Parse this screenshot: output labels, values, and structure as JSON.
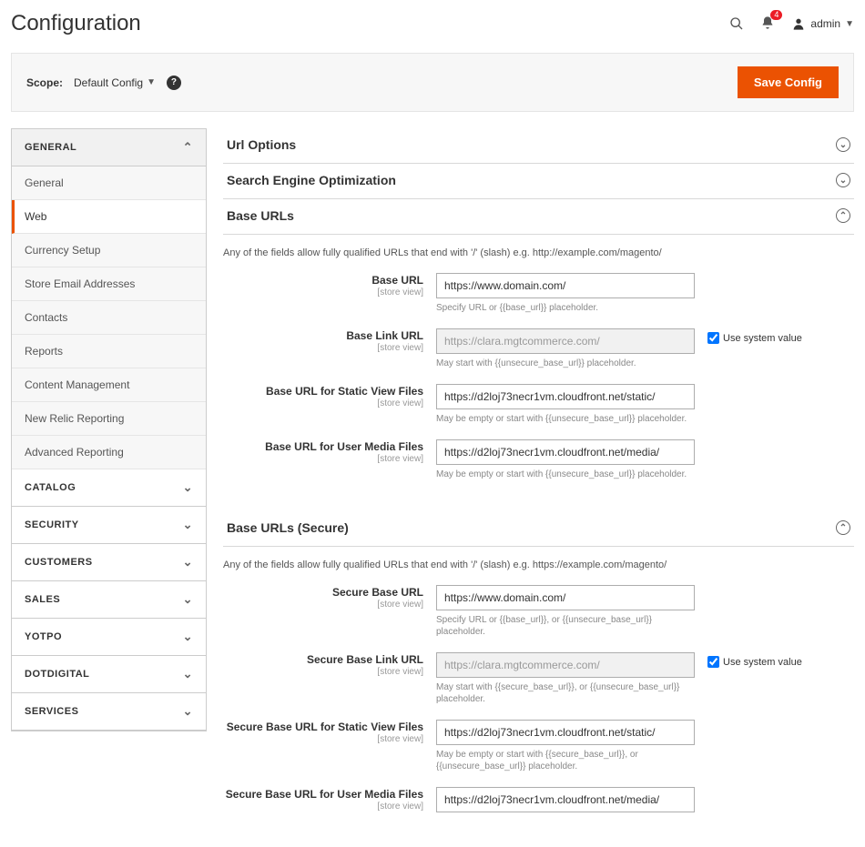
{
  "header": {
    "title": "Configuration",
    "notification_count": "4",
    "username": "admin"
  },
  "scopebar": {
    "label": "Scope:",
    "selected": "Default Config",
    "save_label": "Save Config"
  },
  "sidebar": {
    "groups": [
      {
        "label": "GENERAL",
        "expanded": true,
        "items": [
          {
            "label": "General"
          },
          {
            "label": "Web",
            "active": true
          },
          {
            "label": "Currency Setup"
          },
          {
            "label": "Store Email Addresses"
          },
          {
            "label": "Contacts"
          },
          {
            "label": "Reports"
          },
          {
            "label": "Content Management"
          },
          {
            "label": "New Relic Reporting"
          },
          {
            "label": "Advanced Reporting"
          }
        ]
      },
      {
        "label": "CATALOG",
        "expanded": false
      },
      {
        "label": "SECURITY",
        "expanded": false
      },
      {
        "label": "CUSTOMERS",
        "expanded": false
      },
      {
        "label": "SALES",
        "expanded": false
      },
      {
        "label": "YOTPO",
        "expanded": false
      },
      {
        "label": "DOTDIGITAL",
        "expanded": false
      },
      {
        "label": "SERVICES",
        "expanded": false
      }
    ]
  },
  "sections": {
    "url_options": {
      "title": "Url Options"
    },
    "seo": {
      "title": "Search Engine Optimization"
    },
    "base_urls": {
      "title": "Base URLs",
      "note": "Any of the fields allow fully qualified URLs that end with '/' (slash) e.g. http://example.com/magento/",
      "fields": {
        "base_url": {
          "label": "Base URL",
          "scope": "[store view]",
          "value": "https://www.domain.com/",
          "help": "Specify URL or {{base_url}} placeholder."
        },
        "base_link_url": {
          "label": "Base Link URL",
          "scope": "[store view]",
          "value": "https://clara.mgtcommerce.com/",
          "help": "May start with {{unsecure_base_url}} placeholder.",
          "use_system": true,
          "use_system_label": "Use system value"
        },
        "static_url": {
          "label": "Base URL for Static View Files",
          "scope": "[store view]",
          "value": "https://d2loj73necr1vm.cloudfront.net/static/",
          "help": "May be empty or start with {{unsecure_base_url}} placeholder."
        },
        "media_url": {
          "label": "Base URL for User Media Files",
          "scope": "[store view]",
          "value": "https://d2loj73necr1vm.cloudfront.net/media/",
          "help": "May be empty or start with {{unsecure_base_url}} placeholder."
        }
      }
    },
    "base_urls_secure": {
      "title": "Base URLs (Secure)",
      "note": "Any of the fields allow fully qualified URLs that end with '/' (slash) e.g. https://example.com/magento/",
      "fields": {
        "secure_base_url": {
          "label": "Secure Base URL",
          "scope": "[store view]",
          "value": "https://www.domain.com/",
          "help": "Specify URL or {{base_url}}, or {{unsecure_base_url}} placeholder."
        },
        "secure_base_link_url": {
          "label": "Secure Base Link URL",
          "scope": "[store view]",
          "value": "https://clara.mgtcommerce.com/",
          "help": "May start with {{secure_base_url}}, or {{unsecure_base_url}} placeholder.",
          "use_system": true,
          "use_system_label": "Use system value"
        },
        "secure_static_url": {
          "label": "Secure Base URL for Static View Files",
          "scope": "[store view]",
          "value": "https://d2loj73necr1vm.cloudfront.net/static/",
          "help": "May be empty or start with {{secure_base_url}}, or {{unsecure_base_url}} placeholder."
        },
        "secure_media_url": {
          "label": "Secure Base URL for User Media Files",
          "scope": "[store view]",
          "value": "https://d2loj73necr1vm.cloudfront.net/media/",
          "help": ""
        }
      }
    }
  }
}
